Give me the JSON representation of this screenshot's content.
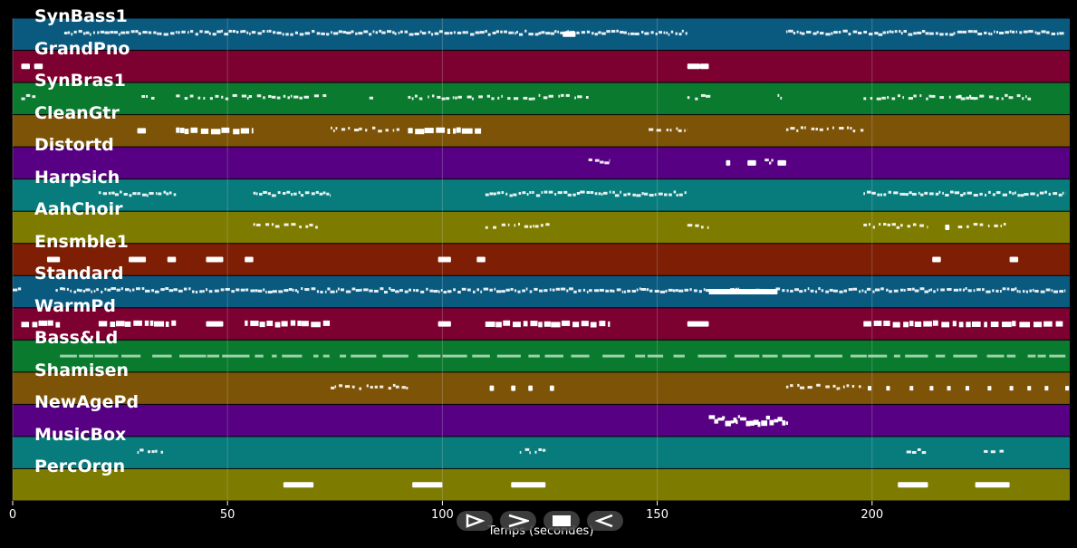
{
  "tracks": [
    {
      "name": "SynBass1",
      "color": "#0a5a80"
    },
    {
      "name": "GrandPno",
      "color": "#7c0030"
    },
    {
      "name": "SynBras1",
      "color": "#0a7a2e"
    },
    {
      "name": "CleanGtr",
      "color": "#7d5407"
    },
    {
      "name": "Distortd",
      "color": "#570083"
    },
    {
      "name": "Harpsich",
      "color": "#087c7c"
    },
    {
      "name": "AahChoir",
      "color": "#7d7c00"
    },
    {
      "name": "Ensmble1",
      "color": "#7d1e05"
    },
    {
      "name": "Standard",
      "color": "#0a5a80"
    },
    {
      "name": "WarmPd",
      "color": "#7c0030"
    },
    {
      "name": "Bass&Ld",
      "color": "#0a7a2e"
    },
    {
      "name": "Shamisen",
      "color": "#7d5407"
    },
    {
      "name": "NewAgePd",
      "color": "#570083"
    },
    {
      "name": "MusicBox",
      "color": "#087c7c"
    },
    {
      "name": "PercOrgn",
      "color": "#7d7c00"
    }
  ],
  "axis": {
    "xlabel": "Temps (secondes)",
    "xlim": [
      0,
      246
    ],
    "ticks": [
      0,
      50,
      100,
      150,
      200
    ],
    "tick_labels": [
      "0",
      "50",
      "100",
      "150",
      "200"
    ]
  },
  "notes": [
    {
      "track": 0,
      "segments": [
        [
          12,
          157,
          "dense"
        ],
        [
          180,
          245,
          "dense"
        ],
        [
          128,
          131,
          "block"
        ]
      ]
    },
    {
      "track": 1,
      "segments": [
        [
          2,
          4,
          "block"
        ],
        [
          5,
          7,
          "block"
        ],
        [
          157,
          160,
          "block"
        ],
        [
          160,
          162,
          "block"
        ]
      ]
    },
    {
      "track": 2,
      "segments": [
        [
          2,
          6,
          "sparse"
        ],
        [
          30,
          33,
          "sparse"
        ],
        [
          38,
          73,
          "sparse"
        ],
        [
          83,
          84,
          "sparse"
        ],
        [
          92,
          134,
          "sparse"
        ],
        [
          157,
          163,
          "sparse"
        ],
        [
          178,
          179,
          "sparse"
        ],
        [
          198,
          224,
          "sparse"
        ],
        [
          220,
          237,
          "sparse"
        ]
      ]
    },
    {
      "track": 3,
      "segments": [
        [
          29,
          31,
          "block"
        ],
        [
          38,
          56,
          "blocks"
        ],
        [
          74,
          90,
          "sparse"
        ],
        [
          92,
          109,
          "blocks"
        ],
        [
          148,
          157,
          "sparse"
        ],
        [
          180,
          198,
          "sparse"
        ]
      ]
    },
    {
      "track": 4,
      "segments": [
        [
          134,
          139,
          "sparse"
        ],
        [
          166,
          167,
          "block"
        ],
        [
          171,
          173,
          "block"
        ],
        [
          175,
          177,
          "sparse"
        ],
        [
          178,
          180,
          "block"
        ]
      ]
    },
    {
      "track": 5,
      "segments": [
        [
          20,
          38,
          "dense"
        ],
        [
          56,
          74,
          "dense"
        ],
        [
          110,
          157,
          "dense"
        ],
        [
          198,
          245,
          "dense"
        ]
      ]
    },
    {
      "track": 6,
      "segments": [
        [
          56,
          71,
          "sparse"
        ],
        [
          110,
          125,
          "sparse"
        ],
        [
          157,
          162,
          "sparse"
        ],
        [
          198,
          213,
          "sparse"
        ],
        [
          217,
          218,
          "block"
        ],
        [
          220,
          232,
          "sparse"
        ]
      ]
    },
    {
      "track": 7,
      "segments": [
        [
          8,
          11,
          "block"
        ],
        [
          27,
          31,
          "block"
        ],
        [
          36,
          38,
          "block"
        ],
        [
          45,
          49,
          "block"
        ],
        [
          54,
          56,
          "block"
        ],
        [
          99,
          102,
          "block"
        ],
        [
          108,
          110,
          "block"
        ],
        [
          214,
          216,
          "block"
        ],
        [
          232,
          234,
          "block"
        ]
      ]
    },
    {
      "track": 8,
      "segments": [
        [
          0,
          2,
          "dense"
        ],
        [
          10,
          245,
          "dense"
        ],
        [
          162,
          178,
          "block"
        ]
      ]
    },
    {
      "track": 9,
      "segments": [
        [
          2,
          11,
          "blocks"
        ],
        [
          20,
          38,
          "blocks"
        ],
        [
          45,
          49,
          "block"
        ],
        [
          54,
          74,
          "blocks"
        ],
        [
          99,
          102,
          "block"
        ],
        [
          110,
          139,
          "blocks"
        ],
        [
          157,
          162,
          "block"
        ],
        [
          198,
          245,
          "blocks"
        ]
      ]
    },
    {
      "track": 10,
      "segments": [
        [
          11,
          245,
          "thin"
        ]
      ]
    },
    {
      "track": 11,
      "segments": [
        [
          74,
          92,
          "sparse"
        ],
        [
          111,
          112,
          "block"
        ],
        [
          116,
          117,
          "block"
        ],
        [
          120,
          121,
          "block"
        ],
        [
          125,
          126,
          "block"
        ],
        [
          180,
          198,
          "sparse"
        ],
        [
          199,
          245,
          "dotted"
        ]
      ]
    },
    {
      "track": 12,
      "segments": [
        [
          162,
          180,
          "dense-big"
        ]
      ]
    },
    {
      "track": 13,
      "segments": [
        [
          29,
          35,
          "sparse"
        ],
        [
          118,
          124,
          "sparse"
        ],
        [
          208,
          213,
          "sparse"
        ],
        [
          226,
          231,
          "sparse"
        ]
      ]
    },
    {
      "track": 14,
      "segments": [
        [
          63,
          70,
          "block"
        ],
        [
          93,
          100,
          "block"
        ],
        [
          116,
          124,
          "block"
        ],
        [
          206,
          213,
          "block"
        ],
        [
          224,
          232,
          "block"
        ]
      ]
    }
  ],
  "controls": [
    {
      "name": "play-icon",
      "label": "play"
    },
    {
      "name": "next-icon",
      "label": "next"
    },
    {
      "name": "stop-icon",
      "label": "stop"
    },
    {
      "name": "rewind-icon",
      "label": "rewind"
    }
  ]
}
